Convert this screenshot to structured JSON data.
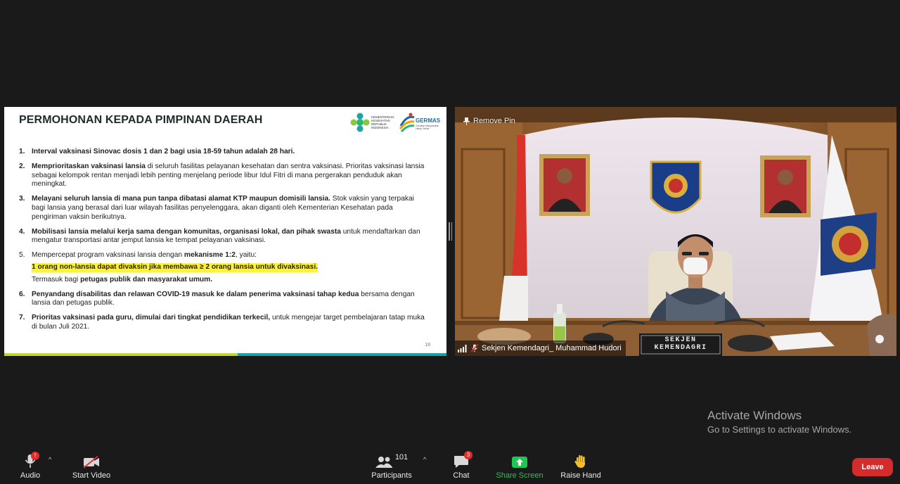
{
  "slide": {
    "title": "PERMOHONAN KEPADA PIMPINAN DAERAH",
    "logo_kemenkes_text": [
      "KEMENTERIAN",
      "KESEHATAN",
      "REPUBLIK",
      "INDONESIA"
    ],
    "logo_germas_text": "GERMAS",
    "logo_germas_sub": "Gerakan Masyarakat Hidup Sehat",
    "items": [
      {
        "num": "1.",
        "bold": "Interval vaksinasi Sinovac dosis 1 dan 2 bagi usia 18-59 tahun adalah 28 hari.",
        "rest": ""
      },
      {
        "num": "2.",
        "bold": "Memprioritaskan vaksinasi lansia",
        "rest": " di seluruh fasilitas pelayanan kesehatan dan sentra vaksinasi. Prioritas vaksinasi lansia sebagai kelompok rentan menjadi lebih penting menjelang periode libur Idul Fitri di mana pergerakan penduduk akan meningkat."
      },
      {
        "num": "3.",
        "bold": "Melayani seluruh lansia di mana pun tanpa dibatasi alamat KTP maupun domisili lansia.",
        "rest": " Stok vaksin yang terpakai bagi lansia yang berasal dari luar wilayah fasilitas penyelenggara, akan diganti oleh Kementerian Kesehatan pada pengiriman vaksin berikutnya."
      },
      {
        "num": "4.",
        "bold": "Mobilisasi lansia melalui kerja sama dengan komunitas, organisasi lokal, dan pihak swasta",
        "rest": " untuk mendaftarkan dan mengatur transportasi antar jemput lansia ke tempat pelayanan vaksinasi."
      }
    ],
    "item5": {
      "num": "5.",
      "pre": "Mempercepat program vaksinasi lansia dengan ",
      "bold": "mekanisme 1:2",
      "post": ", yaitu:",
      "highlight": "1 orang non-lansia dapat divaksin jika membawa ≥ 2 orang lansia untuk divaksinasi.",
      "sub_pre": "Termasuk bagi ",
      "sub_bold": "petugas publik dan masyarakat umum."
    },
    "items_tail": [
      {
        "num": "6.",
        "bold": "Penyandang disabilitas dan relawan COVID-19 masuk ke dalam penerima vaksinasi tahap kedua",
        "rest": " bersama dengan lansia dan petugas publik."
      },
      {
        "num": "7.",
        "bold": "Prioritas vaksinasi pada guru, dimulai dari tingkat pendidikan terkecil,",
        "rest": " untuk mengejar target pembelajaran tatap muka di bulan Juli 2021."
      }
    ],
    "page_number": "18"
  },
  "video": {
    "remove_pin": "Remove Pin",
    "participant_name": "Sekjen Kemendagri_ Muhammad Hudori",
    "desk_sign_line1": "SEKJEN",
    "desk_sign_line2": "KEMENDAGRI"
  },
  "watermark": {
    "line1": "Activate Windows",
    "line2": "Go to Settings to activate Windows."
  },
  "toolbar": {
    "audio": "Audio",
    "audio_badge": "!",
    "start_video": "Start Video",
    "participants": "Participants",
    "participants_count": "101",
    "chat": "Chat",
    "chat_badge": "3",
    "share_screen": "Share Screen",
    "raise_hand": "Raise Hand",
    "leave": "Leave"
  },
  "colors": {
    "share_green": "#23c552",
    "leave_red": "#d42c2c",
    "slide_title": "#1f2a2a",
    "highlight": "#fff23a",
    "bar_lime": "#c3d62f",
    "bar_teal": "#16a3a3"
  }
}
